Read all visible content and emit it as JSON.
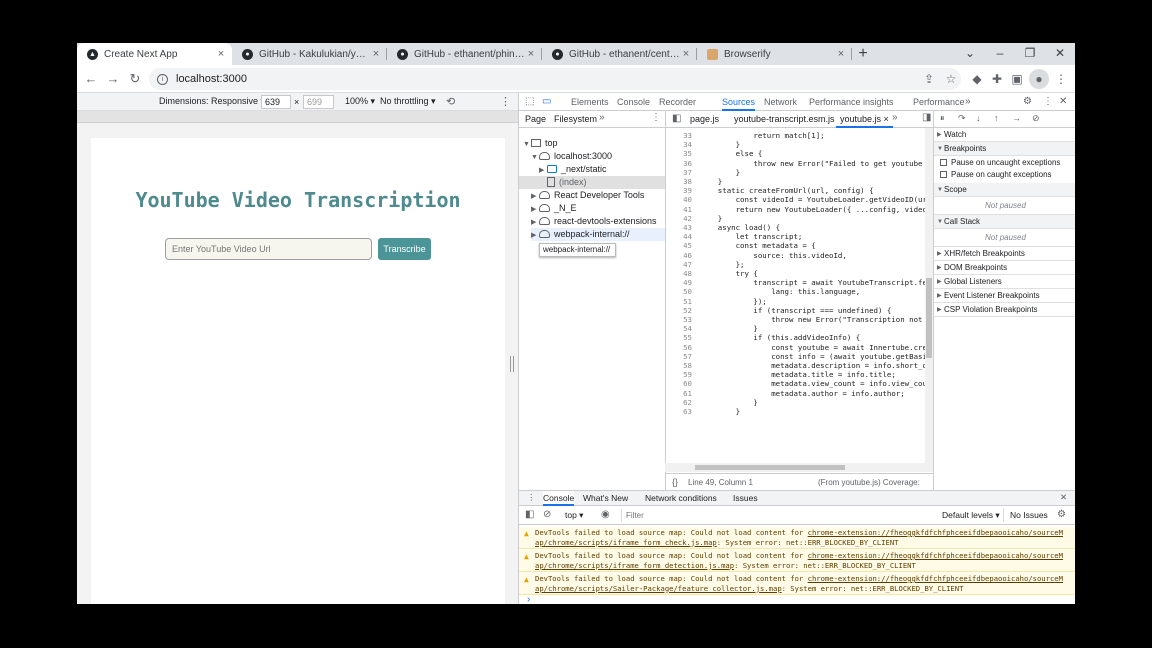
{
  "browser": {
    "tabs": [
      {
        "title": "Create Next App",
        "icon": "nextjs-icon"
      },
      {
        "title": "GitHub - Kakulukian/youtube-tra",
        "icon": "github-icon"
      },
      {
        "title": "GitHub - ethanent/phin: Node HT",
        "icon": "github-icon"
      },
      {
        "title": "GitHub - ethanent/centra: Core N",
        "icon": "github-icon"
      },
      {
        "title": "Browserify",
        "icon": "browserify-icon"
      }
    ],
    "address": "localhost:3000"
  },
  "device_toolbar": {
    "dimensions_label": "Dimensions: Responsive ▾",
    "width": "639",
    "times": "×",
    "height": "699",
    "zoom": "100% ▾",
    "throttle": "No throttling ▾"
  },
  "page": {
    "title": "YouTube Video Transcription",
    "input_placeholder": "Enter YouTube Video Url",
    "button_label": "Transcribe"
  },
  "devtools": {
    "tabs": [
      "Elements",
      "Console",
      "Recorder",
      "Sources",
      "Network",
      "Performance insights",
      "Performance"
    ],
    "active_tab": "Sources",
    "navigator_tabs": [
      "Page",
      "Filesystem"
    ],
    "tree": [
      {
        "label": "top",
        "indent": 0,
        "arrow": "▼",
        "icon": "frame"
      },
      {
        "label": "localhost:3000",
        "indent": 1,
        "arrow": "▼",
        "icon": "cloud"
      },
      {
        "label": "_next/static",
        "indent": 2,
        "arrow": "▶",
        "icon": "folder"
      },
      {
        "label": "(index)",
        "indent": 3,
        "arrow": "",
        "icon": "file"
      },
      {
        "label": "React Developer Tools",
        "indent": 1,
        "arrow": "▶",
        "icon": "cloud"
      },
      {
        "label": "_N_E",
        "indent": 1,
        "arrow": "▶",
        "icon": "cloud"
      },
      {
        "label": "react-devtools-extensions",
        "indent": 1,
        "arrow": "▶",
        "icon": "cloud"
      },
      {
        "label": "webpack-internal://",
        "indent": 1,
        "arrow": "▶",
        "icon": "cloud"
      }
    ],
    "tooltip": "webpack-internal://",
    "editor_tabs": [
      "page.js",
      "youtube-transcript.esm.js",
      "youtube.js"
    ],
    "active_editor_tab": "youtube.js",
    "code": [
      {
        "n": "33",
        "t": "            return match[1];"
      },
      {
        "n": "34",
        "t": "        }"
      },
      {
        "n": "35",
        "t": "        else {"
      },
      {
        "n": "36",
        "t": "            throw new Error(\"Failed to get youtube vi"
      },
      {
        "n": "37",
        "t": "        }"
      },
      {
        "n": "38",
        "t": "    }"
      },
      {
        "n": "39",
        "t": "    static createFromUrl(url, config) {"
      },
      {
        "n": "40",
        "t": "        const videoId = YoutubeLoader.getVideoID(url)"
      },
      {
        "n": "41",
        "t": "        return new YoutubeLoader({ ...config, videoId"
      },
      {
        "n": "42",
        "t": "    }"
      },
      {
        "n": "43",
        "t": "    async load() {"
      },
      {
        "n": "44",
        "t": "        let transcript;"
      },
      {
        "n": "45",
        "t": "        const metadata = {"
      },
      {
        "n": "46",
        "t": "            source: this.videoId,"
      },
      {
        "n": "47",
        "t": "        };"
      },
      {
        "n": "48",
        "t": "        try {"
      },
      {
        "n": "49",
        "t": "            transcript = await YoutubeTranscript.fetch"
      },
      {
        "n": "50",
        "t": "                lang: this.language,"
      },
      {
        "n": "51",
        "t": "            });"
      },
      {
        "n": "52",
        "t": "            if (transcript === undefined) {"
      },
      {
        "n": "53",
        "t": "                throw new Error(\"Transcription not for"
      },
      {
        "n": "54",
        "t": "            }"
      },
      {
        "n": "55",
        "t": "            if (this.addVideoInfo) {"
      },
      {
        "n": "56",
        "t": "                const youtube = await Innertube.create"
      },
      {
        "n": "57",
        "t": "                const info = (await youtube.getBasicIn"
      },
      {
        "n": "58",
        "t": "                metadata.description = info.short_desc"
      },
      {
        "n": "59",
        "t": "                metadata.title = info.title;"
      },
      {
        "n": "60",
        "t": "                metadata.view_count = info.view_count"
      },
      {
        "n": "61",
        "t": "                metadata.author = info.author;"
      },
      {
        "n": "62",
        "t": "            }"
      },
      {
        "n": "63",
        "t": "        }"
      }
    ],
    "status_line": "Line 49, Column 1",
    "status_from": "(From youtube.js) Coverage: n/a",
    "debugger": {
      "watch": "Watch",
      "breakpoints": "Breakpoints",
      "pause_uncaught": "Pause on uncaught exceptions",
      "pause_caught": "Pause on caught exceptions",
      "scope": "Scope",
      "not_paused": "Not paused",
      "call_stack": "Call Stack",
      "sections": [
        "XHR/fetch Breakpoints",
        "DOM Breakpoints",
        "Global Listeners",
        "Event Listener Breakpoints",
        "CSP Violation Breakpoints"
      ]
    },
    "drawer_tabs": [
      "Console",
      "What's New",
      "Network conditions",
      "Issues"
    ],
    "console": {
      "context": "top ▾",
      "filter_placeholder": "Filter",
      "levels": "Default levels ▾",
      "issues": "No Issues",
      "prompt": "›",
      "messages": [
        {
          "text": "DevTools failed to load source map: Could not load content for ",
          "link1": "chrome-extension://fheoggkfdfchfphceeifdbepaooicaho/sourceM",
          "link2": "ap/chrome/scripts/iframe_form_check.js.map",
          "tail": ": System error: net::ERR_BLOCKED_BY_CLIENT"
        },
        {
          "text": "DevTools failed to load source map: Could not load content for ",
          "link1": "chrome-extension://fheoggkfdfchfphceeifdbepaooicaho/sourceM",
          "link2": "ap/chrome/scripts/iframe_form_detection.js.map",
          "tail": ": System error: net::ERR_BLOCKED_BY_CLIENT"
        },
        {
          "text": "DevTools failed to load source map: Could not load content for ",
          "link1": "chrome-extension://fheoggkfdfchfphceeifdbepaooicaho/sourceM",
          "link2": "ap/chrome/scripts/Sailer-Package/feature_collector.js.map",
          "tail": ": System error: net::ERR_BLOCKED_BY_CLIENT"
        }
      ]
    }
  }
}
